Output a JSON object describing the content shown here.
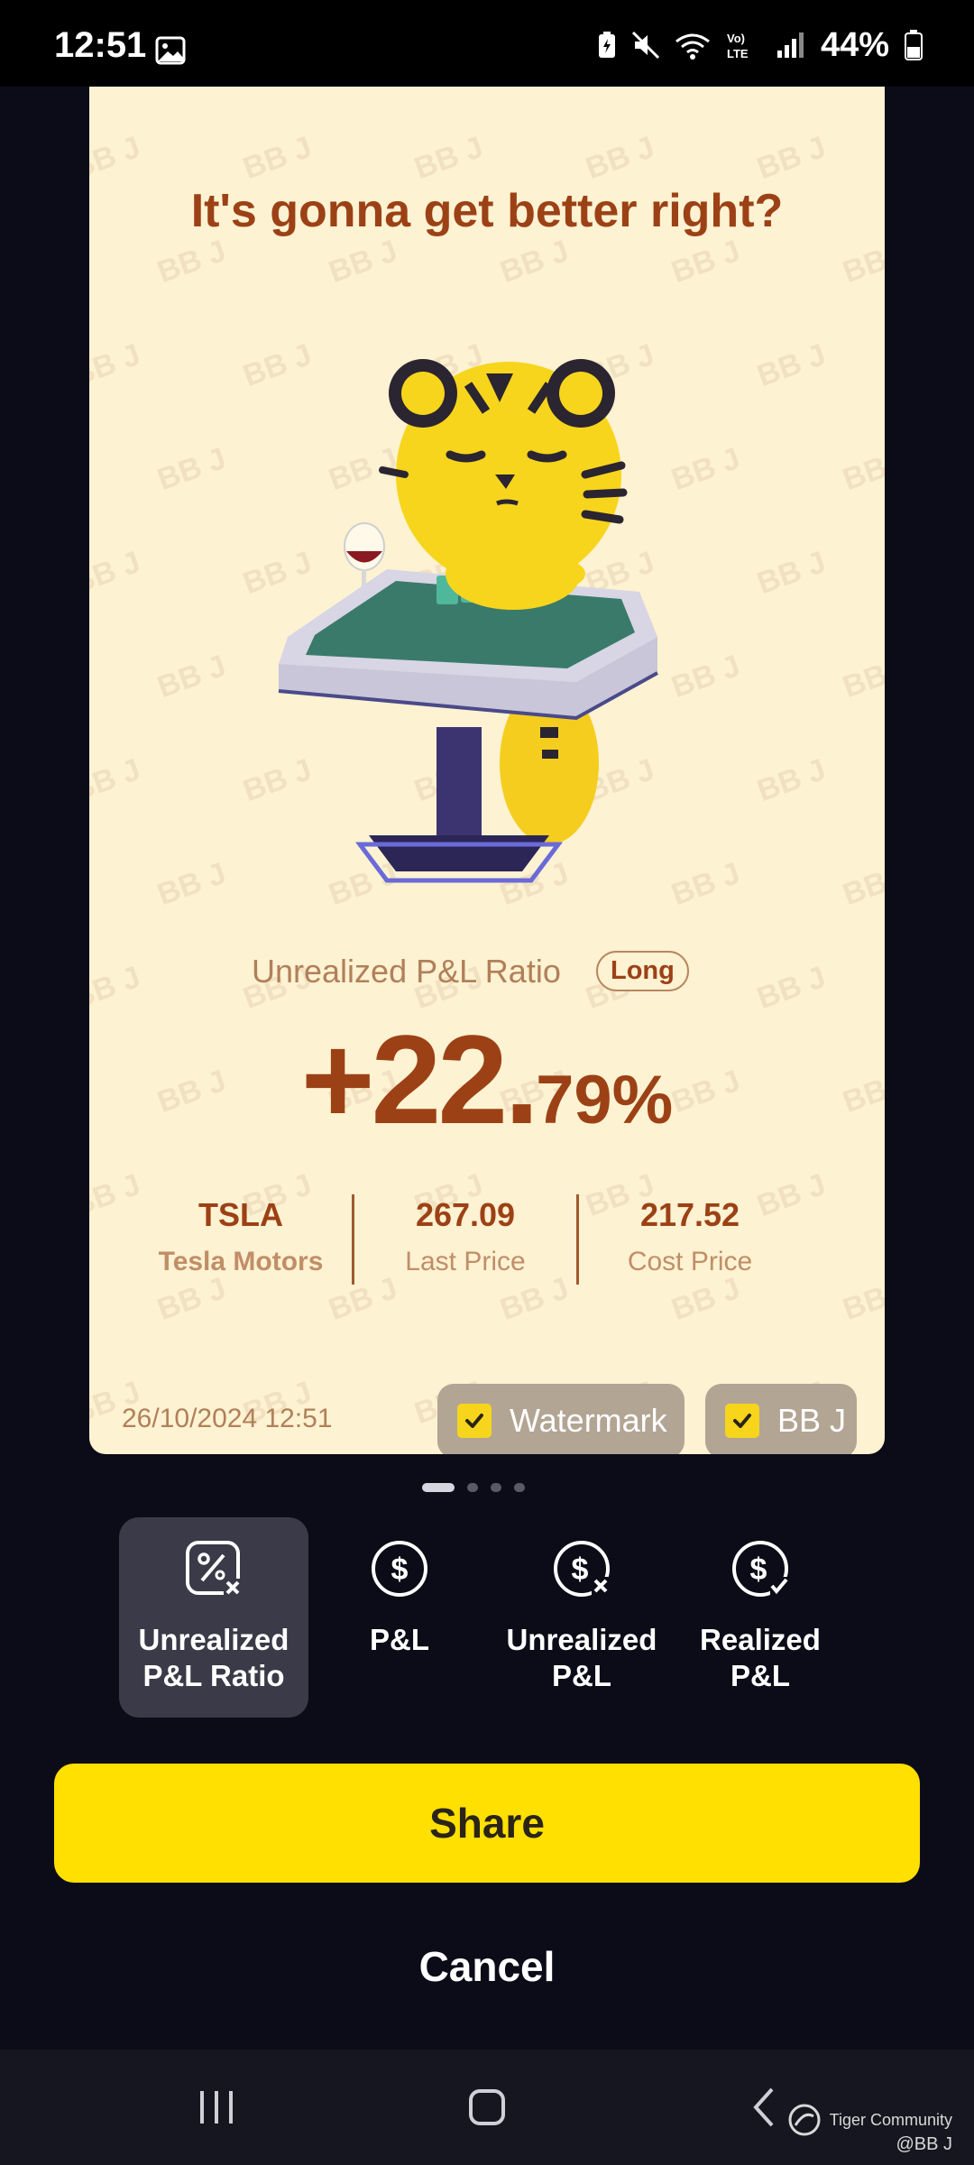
{
  "status_bar": {
    "time": "12:51",
    "battery": "44%"
  },
  "card": {
    "title": "It's gonna get better right?",
    "watermark_text": "BB J",
    "ratio_label": "Unrealized P&L Ratio",
    "badge": "Long",
    "big_value_int": "+22.",
    "big_value_dec": "79%",
    "stats": [
      {
        "value": "TSLA",
        "label": "Tesla Motors"
      },
      {
        "value": "267.09",
        "label": "Last Price"
      },
      {
        "value": "217.52",
        "label": "Cost Price"
      }
    ],
    "date": "26/10/2024 12:51",
    "chips": [
      {
        "label": "Watermark",
        "checked": true
      },
      {
        "label": "BB J",
        "checked": true
      }
    ]
  },
  "pager": {
    "count": 4,
    "active": 0
  },
  "options": [
    {
      "label": "Unrealized\nP&L Ratio",
      "icon": "percent-cross-icon",
      "selected": true
    },
    {
      "label": "P&L",
      "icon": "dollar-circle-icon",
      "selected": false
    },
    {
      "label": "Unrealized\nP&L",
      "icon": "dollar-cross-icon",
      "selected": false
    },
    {
      "label": "Realized\nP&L",
      "icon": "dollar-check-icon",
      "selected": false
    }
  ],
  "buttons": {
    "share": "Share",
    "cancel": "Cancel"
  },
  "footer": {
    "community": "Tiger Community",
    "handle": "@BB J"
  },
  "colors": {
    "accent": "#ffe000",
    "card_bg": "#fdf2d2",
    "brown": "#9c4116",
    "app_bg": "#0c0c18"
  }
}
